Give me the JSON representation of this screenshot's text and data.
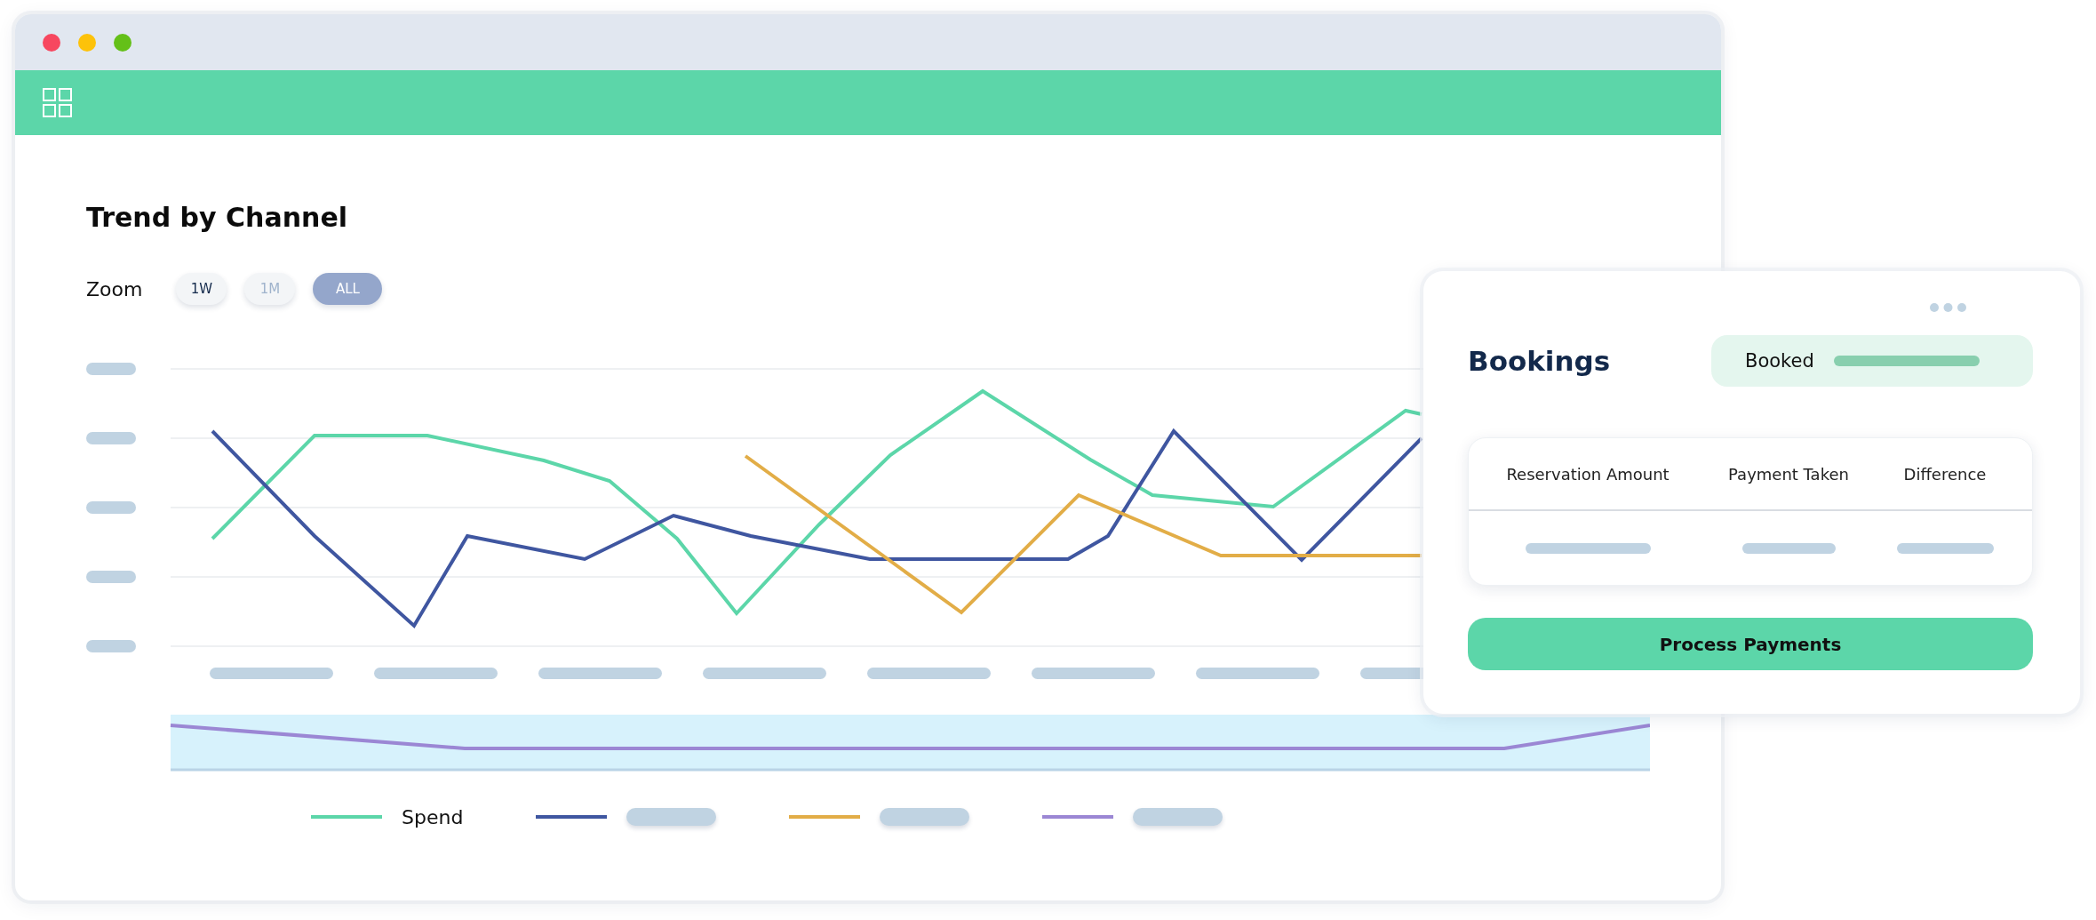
{
  "chart_panel": {
    "title": "Trend by Channel",
    "zoom": {
      "label": "Zoom",
      "options": [
        {
          "label": "1W",
          "selected": false,
          "disabled": false
        },
        {
          "label": "1M",
          "selected": false,
          "disabled": true
        },
        {
          "label": "ALL",
          "selected": true,
          "disabled": false
        }
      ]
    },
    "legend": [
      {
        "kind": "labeled",
        "label": "Spend",
        "color": "#5cd6a9"
      },
      {
        "kind": "placeholder",
        "color": "#3f56a0"
      },
      {
        "kind": "placeholder",
        "color": "#e2ad47"
      },
      {
        "kind": "placeholder",
        "color": "#9b87d4"
      }
    ]
  },
  "bookings_card": {
    "title": "Bookings",
    "status": {
      "label": "Booked"
    },
    "table": {
      "columns": [
        "Reservation Amount",
        "Payment Taken",
        "Difference"
      ]
    },
    "button": "Process Payments"
  }
}
